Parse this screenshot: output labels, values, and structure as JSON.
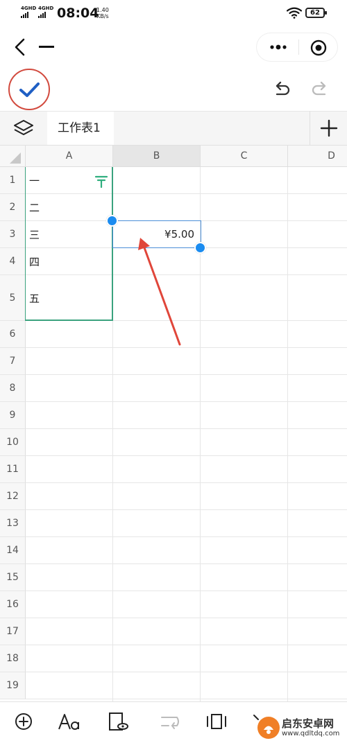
{
  "status_bar": {
    "signal_1": "4GHD",
    "signal_2": "4GHD",
    "time": "08:04",
    "speed_value": "1.40",
    "speed_unit": "KB/s",
    "battery": "62"
  },
  "nav": {
    "back_icon": "chevron-left-icon",
    "more_icon": "more-dots-icon",
    "close_icon": "target-circle-icon"
  },
  "toolbar": {
    "confirm_icon": "checkmark-icon",
    "undo_icon": "undo-icon",
    "redo_icon": "redo-icon"
  },
  "sheet_tabs": {
    "active_tab": "工作表1",
    "add_icon": "plus-icon",
    "layers_icon": "layers-icon"
  },
  "columns": [
    "A",
    "B",
    "C",
    "D"
  ],
  "rows": [
    "1",
    "2",
    "3",
    "4",
    "5",
    "6",
    "7",
    "8",
    "9",
    "10",
    "11",
    "12",
    "13",
    "14",
    "15",
    "16",
    "17",
    "18",
    "19"
  ],
  "cells": {
    "A1": "一",
    "A2": "二",
    "A3": "三",
    "A4": "四",
    "A5": "五",
    "B3": "¥5.00"
  },
  "selection": {
    "selected_cell": "B3",
    "selected_column": "B",
    "border_color": "#4a8ed8",
    "handle_color": "#1b8cf0",
    "range_color": "#3aa27e"
  },
  "annotation": {
    "arrow_color": "#e0463a"
  },
  "bottom_toolbar": {
    "items": [
      "add-circle-icon",
      "font-format-icon",
      "cell-view-icon",
      "wrap-text-icon",
      "column-adjust-icon",
      "more-icon"
    ]
  },
  "watermark": {
    "name": "启东安卓网",
    "url": "www.qdltdq.com"
  }
}
